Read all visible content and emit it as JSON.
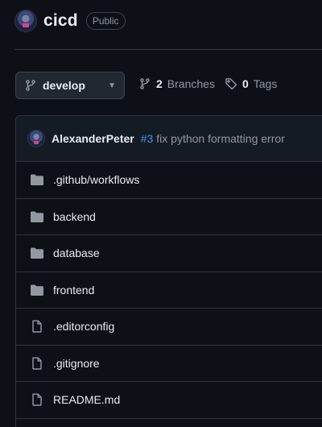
{
  "repo": {
    "name": "cicd",
    "visibility": "Public"
  },
  "branch_bar": {
    "current_branch": "develop",
    "branches_count": "2",
    "branches_label": "Branches",
    "tags_count": "0",
    "tags_label": "Tags"
  },
  "latest_commit": {
    "author": "AlexanderPeter",
    "pr": "#3",
    "message": "fix python formatting error"
  },
  "files": [
    {
      "name": ".github/workflows",
      "type": "folder"
    },
    {
      "name": "backend",
      "type": "folder"
    },
    {
      "name": "database",
      "type": "folder"
    },
    {
      "name": "frontend",
      "type": "folder"
    },
    {
      "name": ".editorconfig",
      "type": "file"
    },
    {
      "name": ".gitignore",
      "type": "file"
    },
    {
      "name": "README.md",
      "type": "file"
    }
  ],
  "colors": {
    "background": "#0d1117",
    "border": "#30363d",
    "muted_text": "#9198a1",
    "link": "#4493f8"
  }
}
